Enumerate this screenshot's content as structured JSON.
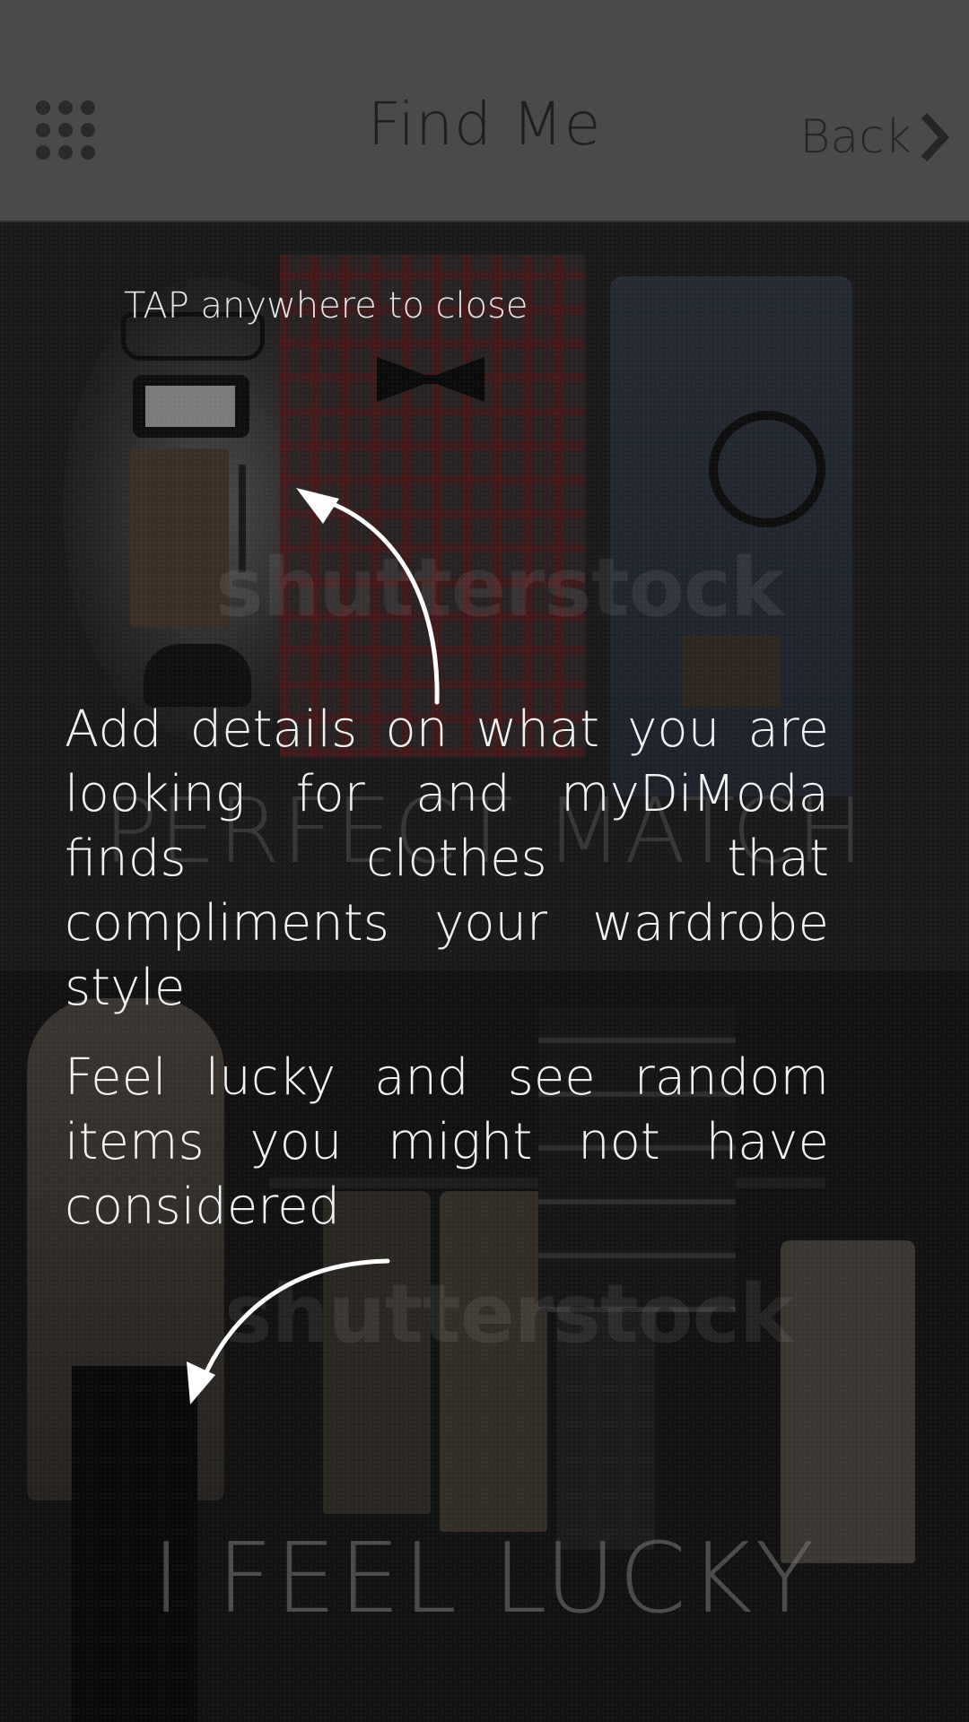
{
  "header": {
    "title": "Find Me",
    "back_label": "Back",
    "menu_icon": "grid-dots-icon",
    "back_icon": "chevron-right-icon"
  },
  "sections": {
    "top": {
      "label": "PERFECT MATCH",
      "watermark": "shutterstock"
    },
    "bottom": {
      "label": "I FEEL LUCKY",
      "watermark": "shutterstock"
    }
  },
  "overlay": {
    "tap_hint": "TAP anywhere to close",
    "tip_perfect_match": "Add details on what you are looking for and myDiModa finds clothes that compliments your wardrobe style",
    "tip_feel_lucky": "Feel lucky and see random items you might not have considered"
  },
  "colors": {
    "header_bg": "#4a4a4a",
    "overlay_text": "#f2f2f2"
  }
}
